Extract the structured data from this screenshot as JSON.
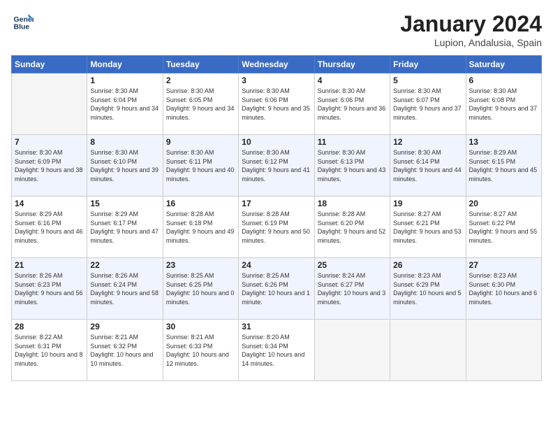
{
  "header": {
    "logo_line1": "General",
    "logo_line2": "Blue",
    "month_title": "January 2024",
    "location": "Lupion, Andalusia, Spain"
  },
  "weekdays": [
    "Sunday",
    "Monday",
    "Tuesday",
    "Wednesday",
    "Thursday",
    "Friday",
    "Saturday"
  ],
  "weeks": [
    [
      {
        "day": "",
        "empty": true
      },
      {
        "day": "1",
        "sunrise": "Sunrise: 8:30 AM",
        "sunset": "Sunset: 6:04 PM",
        "daylight": "Daylight: 9 hours and 34 minutes."
      },
      {
        "day": "2",
        "sunrise": "Sunrise: 8:30 AM",
        "sunset": "Sunset: 6:05 PM",
        "daylight": "Daylight: 9 hours and 34 minutes."
      },
      {
        "day": "3",
        "sunrise": "Sunrise: 8:30 AM",
        "sunset": "Sunset: 6:06 PM",
        "daylight": "Daylight: 9 hours and 35 minutes."
      },
      {
        "day": "4",
        "sunrise": "Sunrise: 8:30 AM",
        "sunset": "Sunset: 6:06 PM",
        "daylight": "Daylight: 9 hours and 36 minutes."
      },
      {
        "day": "5",
        "sunrise": "Sunrise: 8:30 AM",
        "sunset": "Sunset: 6:07 PM",
        "daylight": "Daylight: 9 hours and 37 minutes."
      },
      {
        "day": "6",
        "sunrise": "Sunrise: 8:30 AM",
        "sunset": "Sunset: 6:08 PM",
        "daylight": "Daylight: 9 hours and 37 minutes."
      }
    ],
    [
      {
        "day": "7",
        "sunrise": "Sunrise: 8:30 AM",
        "sunset": "Sunset: 6:09 PM",
        "daylight": "Daylight: 9 hours and 38 minutes."
      },
      {
        "day": "8",
        "sunrise": "Sunrise: 8:30 AM",
        "sunset": "Sunset: 6:10 PM",
        "daylight": "Daylight: 9 hours and 39 minutes."
      },
      {
        "day": "9",
        "sunrise": "Sunrise: 8:30 AM",
        "sunset": "Sunset: 6:11 PM",
        "daylight": "Daylight: 9 hours and 40 minutes."
      },
      {
        "day": "10",
        "sunrise": "Sunrise: 8:30 AM",
        "sunset": "Sunset: 6:12 PM",
        "daylight": "Daylight: 9 hours and 41 minutes."
      },
      {
        "day": "11",
        "sunrise": "Sunrise: 8:30 AM",
        "sunset": "Sunset: 6:13 PM",
        "daylight": "Daylight: 9 hours and 43 minutes."
      },
      {
        "day": "12",
        "sunrise": "Sunrise: 8:30 AM",
        "sunset": "Sunset: 6:14 PM",
        "daylight": "Daylight: 9 hours and 44 minutes."
      },
      {
        "day": "13",
        "sunrise": "Sunrise: 8:29 AM",
        "sunset": "Sunset: 6:15 PM",
        "daylight": "Daylight: 9 hours and 45 minutes."
      }
    ],
    [
      {
        "day": "14",
        "sunrise": "Sunrise: 8:29 AM",
        "sunset": "Sunset: 6:16 PM",
        "daylight": "Daylight: 9 hours and 46 minutes."
      },
      {
        "day": "15",
        "sunrise": "Sunrise: 8:29 AM",
        "sunset": "Sunset: 6:17 PM",
        "daylight": "Daylight: 9 hours and 47 minutes."
      },
      {
        "day": "16",
        "sunrise": "Sunrise: 8:28 AM",
        "sunset": "Sunset: 6:18 PM",
        "daylight": "Daylight: 9 hours and 49 minutes."
      },
      {
        "day": "17",
        "sunrise": "Sunrise: 8:28 AM",
        "sunset": "Sunset: 6:19 PM",
        "daylight": "Daylight: 9 hours and 50 minutes."
      },
      {
        "day": "18",
        "sunrise": "Sunrise: 8:28 AM",
        "sunset": "Sunset: 6:20 PM",
        "daylight": "Daylight: 9 hours and 52 minutes."
      },
      {
        "day": "19",
        "sunrise": "Sunrise: 8:27 AM",
        "sunset": "Sunset: 6:21 PM",
        "daylight": "Daylight: 9 hours and 53 minutes."
      },
      {
        "day": "20",
        "sunrise": "Sunrise: 8:27 AM",
        "sunset": "Sunset: 6:22 PM",
        "daylight": "Daylight: 9 hours and 55 minutes."
      }
    ],
    [
      {
        "day": "21",
        "sunrise": "Sunrise: 8:26 AM",
        "sunset": "Sunset: 6:23 PM",
        "daylight": "Daylight: 9 hours and 56 minutes."
      },
      {
        "day": "22",
        "sunrise": "Sunrise: 8:26 AM",
        "sunset": "Sunset: 6:24 PM",
        "daylight": "Daylight: 9 hours and 58 minutes."
      },
      {
        "day": "23",
        "sunrise": "Sunrise: 8:25 AM",
        "sunset": "Sunset: 6:25 PM",
        "daylight": "Daylight: 10 hours and 0 minutes."
      },
      {
        "day": "24",
        "sunrise": "Sunrise: 8:25 AM",
        "sunset": "Sunset: 6:26 PM",
        "daylight": "Daylight: 10 hours and 1 minute."
      },
      {
        "day": "25",
        "sunrise": "Sunrise: 8:24 AM",
        "sunset": "Sunset: 6:27 PM",
        "daylight": "Daylight: 10 hours and 3 minutes."
      },
      {
        "day": "26",
        "sunrise": "Sunrise: 8:23 AM",
        "sunset": "Sunset: 6:29 PM",
        "daylight": "Daylight: 10 hours and 5 minutes."
      },
      {
        "day": "27",
        "sunrise": "Sunrise: 8:23 AM",
        "sunset": "Sunset: 6:30 PM",
        "daylight": "Daylight: 10 hours and 6 minutes."
      }
    ],
    [
      {
        "day": "28",
        "sunrise": "Sunrise: 8:22 AM",
        "sunset": "Sunset: 6:31 PM",
        "daylight": "Daylight: 10 hours and 8 minutes."
      },
      {
        "day": "29",
        "sunrise": "Sunrise: 8:21 AM",
        "sunset": "Sunset: 6:32 PM",
        "daylight": "Daylight: 10 hours and 10 minutes."
      },
      {
        "day": "30",
        "sunrise": "Sunrise: 8:21 AM",
        "sunset": "Sunset: 6:33 PM",
        "daylight": "Daylight: 10 hours and 12 minutes."
      },
      {
        "day": "31",
        "sunrise": "Sunrise: 8:20 AM",
        "sunset": "Sunset: 6:34 PM",
        "daylight": "Daylight: 10 hours and 14 minutes."
      },
      {
        "day": "",
        "empty": true
      },
      {
        "day": "",
        "empty": true
      },
      {
        "day": "",
        "empty": true
      }
    ]
  ]
}
